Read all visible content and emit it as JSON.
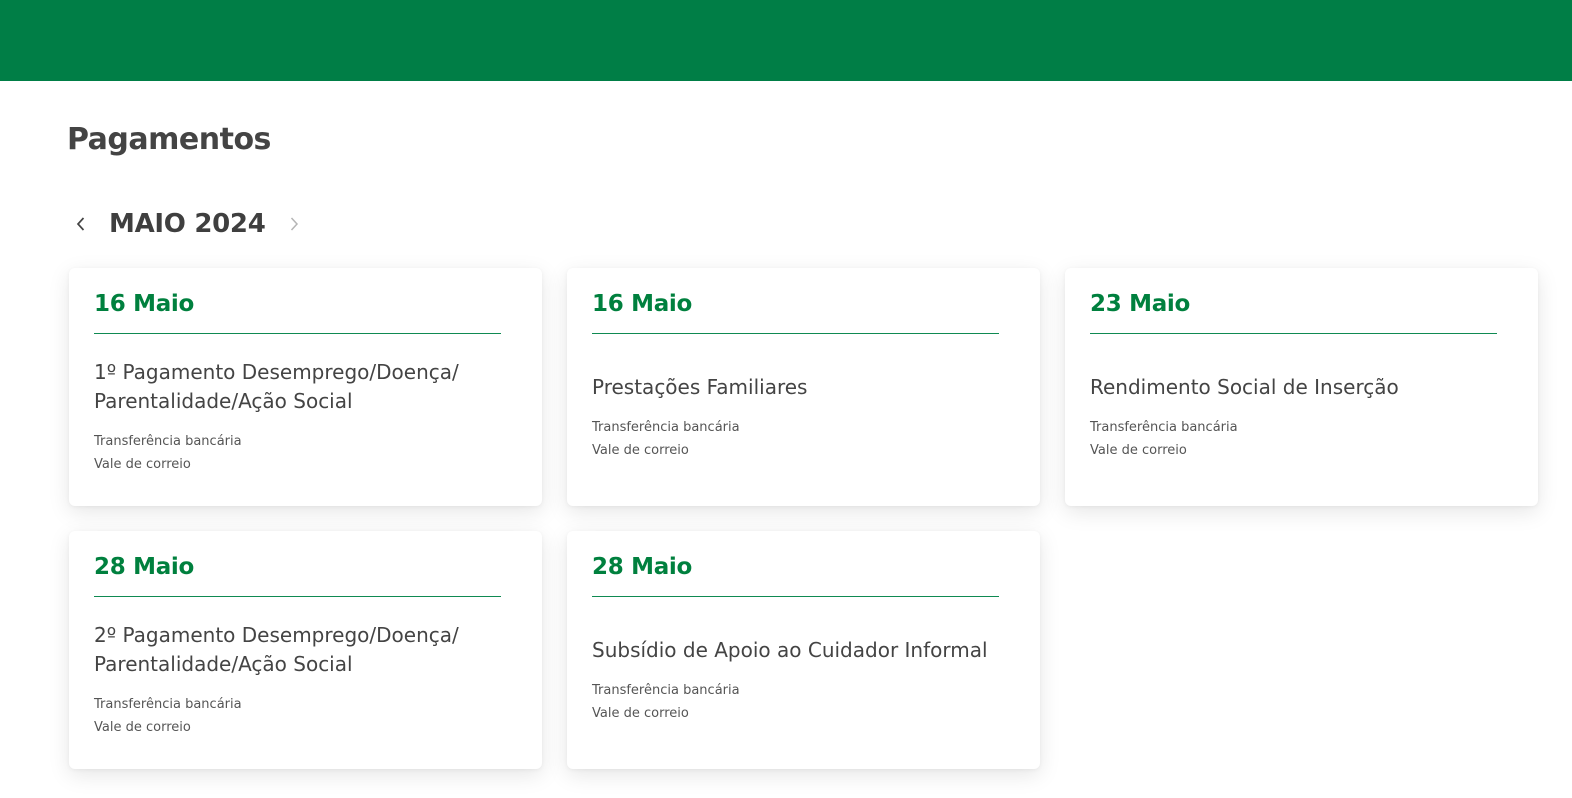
{
  "colors": {
    "header_bg": "#007e46",
    "accent": "#00803e",
    "text": "#444444"
  },
  "page": {
    "title": "Pagamentos"
  },
  "month_nav": {
    "label": "MAIO 2024",
    "prev_icon": "chevron-left-icon",
    "next_icon": "chevron-right-icon"
  },
  "cards": [
    {
      "date": "16 Maio",
      "title_line1": "1º Pagamento Desemprego/Doença/",
      "title_line2": "Parentalidade/Ação Social",
      "methods": [
        "Transferência bancária",
        "Vale de correio"
      ]
    },
    {
      "date": "16 Maio",
      "title_line1": "Prestações Familiares",
      "title_line2": "",
      "methods": [
        "Transferência bancária",
        "Vale de correio"
      ]
    },
    {
      "date": "23 Maio",
      "title_line1": "Rendimento Social de Inserção",
      "title_line2": "",
      "methods": [
        "Transferência bancária",
        "Vale de correio"
      ]
    },
    {
      "date": "28 Maio",
      "title_line1": "2º Pagamento Desemprego/Doença/",
      "title_line2": "Parentalidade/Ação Social",
      "methods": [
        "Transferência bancária",
        "Vale de correio"
      ]
    },
    {
      "date": "28 Maio",
      "title_line1": "Subsídio de Apoio ao Cuidador Informal",
      "title_line2": "",
      "methods": [
        "Transferência bancária",
        "Vale de correio"
      ]
    }
  ]
}
